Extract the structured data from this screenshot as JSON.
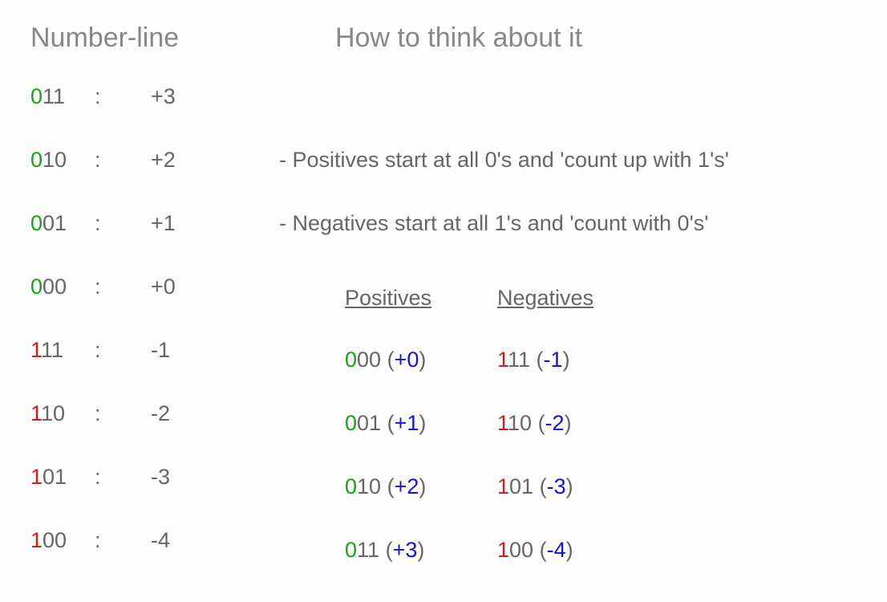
{
  "headers": {
    "left": "Number-line",
    "right": "How to think about it"
  },
  "rows": [
    {
      "sign": "pos",
      "b0": "0",
      "b12": "11",
      "colon": ":",
      "val": "+3",
      "note": ""
    },
    {
      "sign": "pos",
      "b0": "0",
      "b12": "10",
      "colon": ":",
      "val": "+2",
      "note": "- Positives start at all 0's and 'count up with 1's'"
    },
    {
      "sign": "pos",
      "b0": "0",
      "b12": "01",
      "colon": ":",
      "val": "+1",
      "note": "- Negatives start at all 1's and 'count with 0's'"
    },
    {
      "sign": "pos",
      "b0": "0",
      "b12": "00",
      "colon": ":",
      "val": "+0",
      "note": ""
    },
    {
      "sign": "neg",
      "b0": "1",
      "b12": "11",
      "colon": ":",
      "val": "-1",
      "note": ""
    },
    {
      "sign": "neg",
      "b0": "1",
      "b12": "10",
      "colon": ":",
      "val": "-2",
      "note": ""
    },
    {
      "sign": "neg",
      "b0": "1",
      "b12": "01",
      "colon": ":",
      "val": "-3",
      "note": ""
    },
    {
      "sign": "neg",
      "b0": "1",
      "b12": "00",
      "colon": ":",
      "val": "-4",
      "note": ""
    }
  ],
  "mini": {
    "head1": "Positives",
    "head2": "Negatives",
    "rows": [
      {
        "p_b0": "0",
        "p_b12": "00",
        "p_open": " (",
        "p_v": "+0",
        "p_close": ")",
        "n_b0": "1",
        "n_b12": "11",
        "n_open": " (",
        "n_v": "-1",
        "n_close": ")"
      },
      {
        "p_b0": "0",
        "p_b12": "01",
        "p_open": " (",
        "p_v": "+1",
        "p_close": ")",
        "n_b0": "1",
        "n_b12": "10",
        "n_open": " (",
        "n_v": "-2",
        "n_close": ")"
      },
      {
        "p_b0": "0",
        "p_b12": "10",
        "p_open": " (",
        "p_v": "+2",
        "p_close": ")",
        "n_b0": "1",
        "n_b12": "01",
        "n_open": " (",
        "n_v": "-3",
        "n_close": ")"
      },
      {
        "p_b0": "0",
        "p_b12": "11",
        "p_open": " (",
        "p_v": "+3",
        "p_close": ")",
        "n_b0": "1",
        "n_b12": "00",
        "n_open": " (",
        "n_v": "-4",
        "n_close": ")"
      }
    ]
  }
}
